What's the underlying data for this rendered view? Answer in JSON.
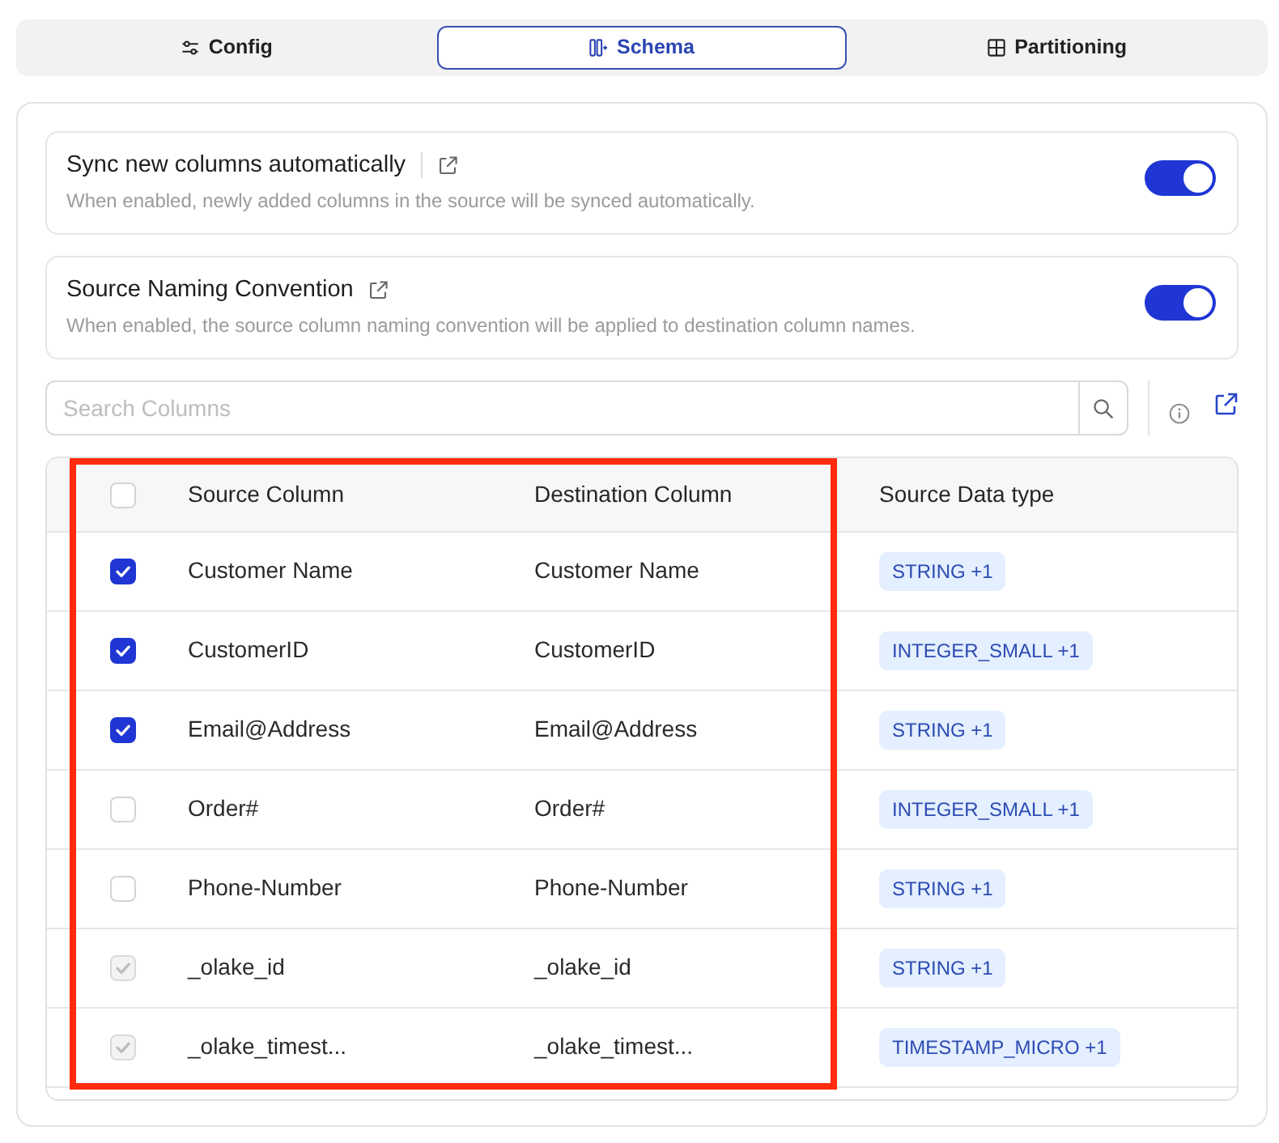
{
  "tabs": [
    {
      "label": "Config",
      "selected": false
    },
    {
      "label": "Schema",
      "selected": true
    },
    {
      "label": "Partitioning",
      "selected": false
    }
  ],
  "settings": [
    {
      "title": "Sync new columns automatically",
      "separator": true,
      "description": "When enabled, newly added columns in the source will be synced automatically.",
      "on": true
    },
    {
      "title": "Source Naming Convention",
      "separator": false,
      "description": "When enabled, the source column naming convention will be applied to destination column names.",
      "on": true
    }
  ],
  "search": {
    "placeholder": "Search Columns"
  },
  "table": {
    "select_all": {
      "checked": false
    },
    "columns": [
      {
        "label": "Source Column",
        "highlighted": true
      },
      {
        "label": "Destination Column",
        "highlighted": true
      },
      {
        "label": "Source Data type",
        "highlighted": false
      }
    ],
    "rows": [
      {
        "source": "Customer Name",
        "destination": "Customer Name",
        "data_type": "STRING +1",
        "checked": true,
        "disabled": false
      },
      {
        "source": "CustomerID",
        "destination": "CustomerID",
        "data_type": "INTEGER_SMALL +1",
        "checked": true,
        "disabled": false
      },
      {
        "source": "Email@Address",
        "destination": "Email@Address",
        "data_type": "STRING +1",
        "checked": true,
        "disabled": false
      },
      {
        "source": "Order#",
        "destination": "Order#",
        "data_type": "INTEGER_SMALL +1",
        "checked": false,
        "disabled": false
      },
      {
        "source": "Phone-Number",
        "destination": "Phone-Number",
        "data_type": "STRING +1",
        "checked": false,
        "disabled": false
      },
      {
        "source": "_olake_id",
        "destination": "_olake_id",
        "data_type": "STRING +1",
        "checked": true,
        "disabled": true
      },
      {
        "source": "_olake_timest...",
        "destination": "_olake_timest...",
        "data_type": "TIMESTAMP_MICRO +1",
        "checked": true,
        "disabled": true
      }
    ]
  }
}
